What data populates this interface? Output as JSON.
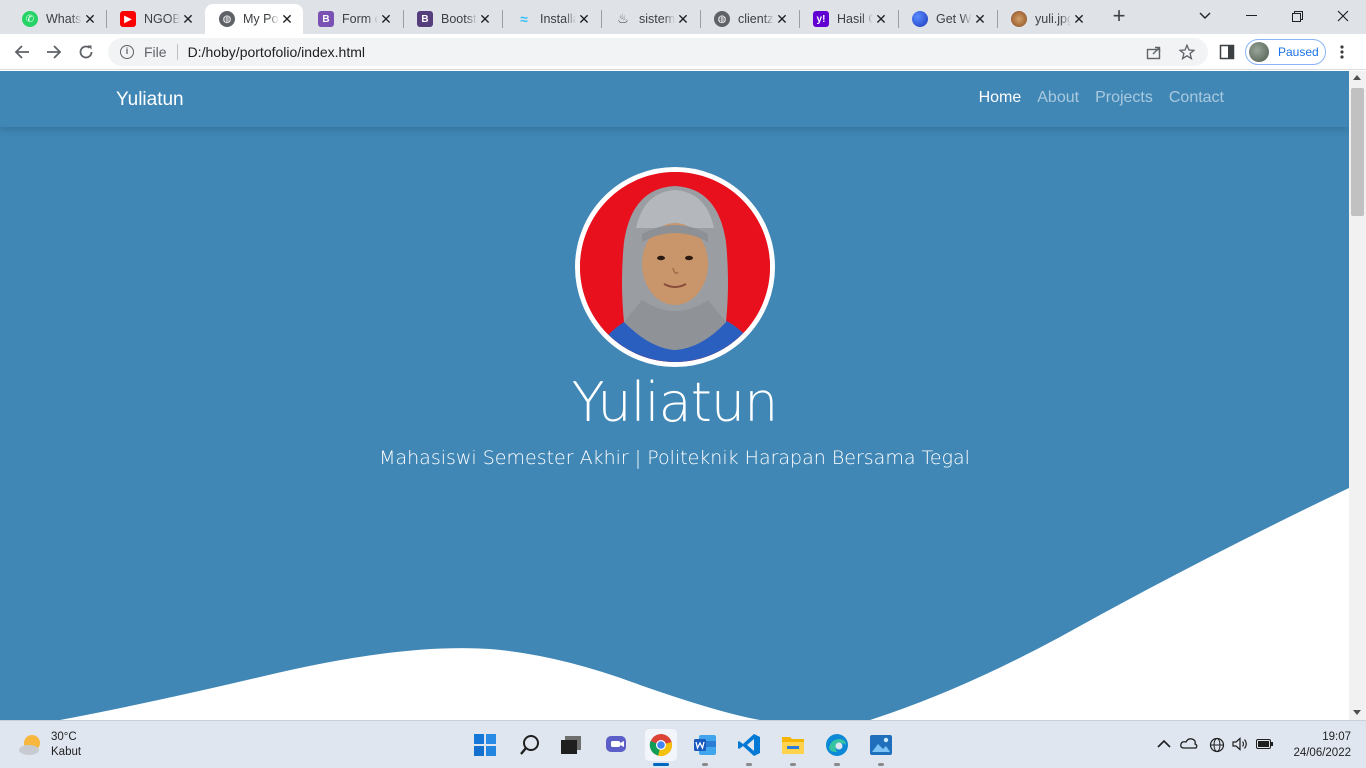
{
  "browser": {
    "tabs": [
      {
        "title": "WhatsApp",
        "icon": "whatsapp-icon",
        "color": "#25d366"
      },
      {
        "title": "NGOBROL",
        "icon": "youtube-icon",
        "color": "#ff0000"
      },
      {
        "title": "My Portofolio",
        "icon": "globe-icon",
        "color": "#5f6368",
        "active": true
      },
      {
        "title": "Form controls",
        "icon": "bootstrap-icon",
        "color": "#7952b3"
      },
      {
        "title": "Bootstrap",
        "icon": "bootstrap-icon",
        "color": "#563d7c"
      },
      {
        "title": "Installation",
        "icon": "tailwind-icon",
        "color": "#38bdf8"
      },
      {
        "title": "sistem",
        "icon": "flame-icon",
        "color": "#555555"
      },
      {
        "title": "clientzone",
        "icon": "globe-icon",
        "color": "#5f6368"
      },
      {
        "title": "Hasil Carian",
        "icon": "yahoo-icon",
        "color": "#6001d2"
      },
      {
        "title": "Get Waves",
        "icon": "wave-app-icon",
        "color": "#1c39bb"
      },
      {
        "title": "yuli.jpg",
        "icon": "image-icon",
        "color": "#a0522d"
      }
    ],
    "new_tab_symbol": "+",
    "address": {
      "scheme": "File",
      "url": "D:/hoby/portofolio/index.html"
    },
    "profile_status": "Paused"
  },
  "page": {
    "brand": "Yuliatun",
    "nav": [
      {
        "label": "Home",
        "active": true
      },
      {
        "label": "About",
        "active": false
      },
      {
        "label": "Projects",
        "active": false
      },
      {
        "label": "Contact",
        "active": false
      }
    ],
    "hero": {
      "name": "Yuliatun",
      "subtitle": "Mahasiswi Semester Akhir | Politeknik Harapan Bersama Tegal"
    },
    "colors": {
      "primary": "#4087b6",
      "text": "#ffffff",
      "photo_bg": "#e8101c"
    }
  },
  "taskbar": {
    "weather": {
      "temp": "30°C",
      "condition": "Kabut"
    },
    "apps": [
      "start-icon",
      "search-icon",
      "task-view-icon",
      "chat-icon",
      "chrome-icon",
      "word-icon",
      "vscode-icon",
      "file-explorer-icon",
      "edge-icon",
      "photos-icon"
    ],
    "clock": {
      "time": "19:07",
      "date": "24/06/2022"
    }
  }
}
